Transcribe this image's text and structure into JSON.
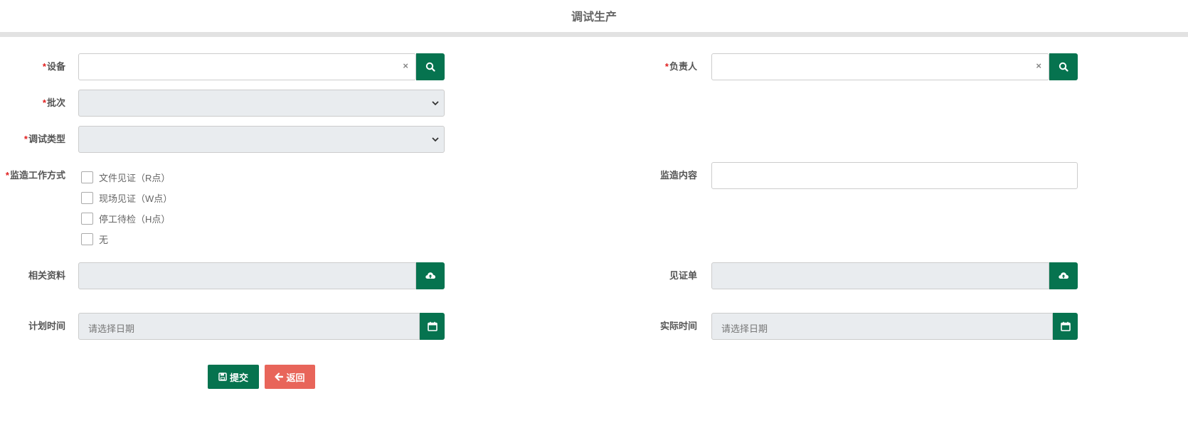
{
  "page": {
    "title": "调试生产"
  },
  "form": {
    "device": {
      "required_mark": "*",
      "label": "设备",
      "value": "",
      "clear": "×"
    },
    "owner": {
      "required_mark": "*",
      "label": "负责人",
      "value": "",
      "clear": "×"
    },
    "batch": {
      "required_mark": "*",
      "label": "批次",
      "selected": ""
    },
    "debug_type": {
      "required_mark": "*",
      "label": "调试类型",
      "selected": ""
    },
    "supervision_mode": {
      "required_mark": "*",
      "label": "监造工作方式",
      "options": [
        {
          "label": "文件见证（R点）",
          "checked": false
        },
        {
          "label": "现场见证（W点）",
          "checked": false
        },
        {
          "label": "停工待检（H点）",
          "checked": false
        },
        {
          "label": "无",
          "checked": false
        }
      ]
    },
    "supervision_content": {
      "label": "监造内容",
      "value": ""
    },
    "related_docs": {
      "label": "相关资料",
      "value": ""
    },
    "witness_sheet": {
      "label": "见证单",
      "value": ""
    },
    "planned_time": {
      "label": "计划时间",
      "placeholder": "请选择日期"
    },
    "actual_time": {
      "label": "实际时间",
      "placeholder": "请选择日期"
    }
  },
  "actions": {
    "submit_label": "提交",
    "back_label": "返回"
  },
  "colors": {
    "primary": "#06734f",
    "danger": "#e8655a",
    "required": "#e02020",
    "disabled_bg": "#e9ecef"
  }
}
